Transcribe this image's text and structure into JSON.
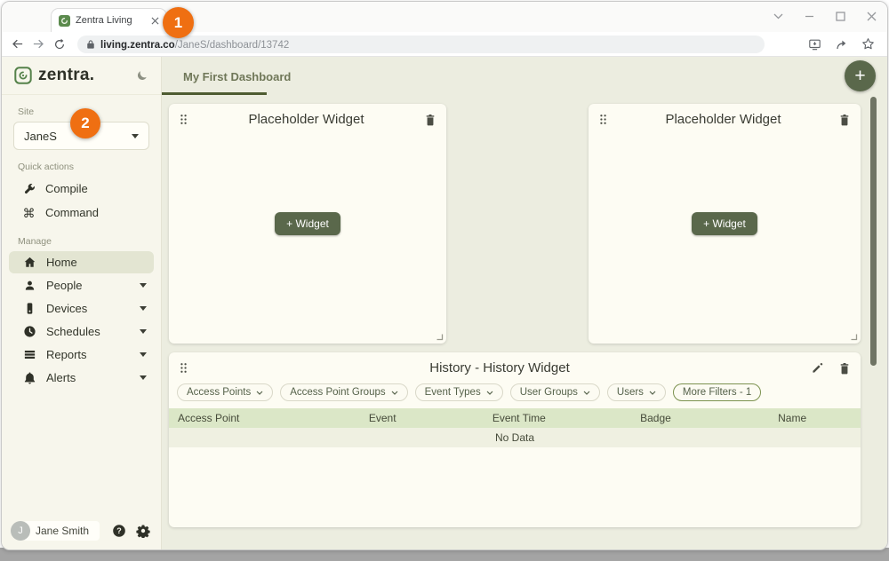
{
  "colors": {
    "accent_olive": "#5a684b",
    "tab_underline": "#4e5c31",
    "brand_green": "#55824a",
    "annotation_orange": "#ef6f12",
    "table_header_green": "#dbe7c7",
    "sidebar_bg": "#f7f6ec",
    "main_bg": "#ecede0",
    "card_bg": "#fdfcf3",
    "active_item_bg": "#e3e5d2"
  },
  "annotations": {
    "steps": [
      "1",
      "2"
    ]
  },
  "browser": {
    "tab_title": "Zentra Living",
    "url_domain": "living.zentra.co",
    "url_path": "/JaneS/dashboard/13742"
  },
  "icons": {
    "command_glyph": "⌘"
  },
  "sidebar": {
    "brand": "zentra.",
    "site_label": "Site",
    "site_value": "JaneS",
    "quick_actions_label": "Quick actions",
    "quick_actions": [
      {
        "label": "Compile"
      },
      {
        "label": "Command"
      }
    ],
    "manage_label": "Manage",
    "items": [
      {
        "label": "Home"
      },
      {
        "label": "People"
      },
      {
        "label": "Devices"
      },
      {
        "label": "Schedules"
      },
      {
        "label": "Reports"
      },
      {
        "label": "Alerts"
      }
    ],
    "user_initial": "J",
    "user_name": "Jane Smith"
  },
  "main": {
    "dashboard_tab": "My First Dashboard",
    "fab_label": "+",
    "widgets": [
      {
        "title": "Placeholder Widget",
        "add_button": "+ Widget"
      },
      {
        "title": "Placeholder Widget",
        "add_button": "+ Widget"
      }
    ],
    "history": {
      "title": "History - History Widget",
      "filters": [
        {
          "label": "Access Points"
        },
        {
          "label": "Access Point Groups"
        },
        {
          "label": "Event Types"
        },
        {
          "label": "User Groups"
        },
        {
          "label": "Users"
        }
      ],
      "more_filters": "More Filters - 1",
      "columns": [
        "Access Point",
        "Event",
        "Event Time",
        "Badge",
        "Name"
      ],
      "empty_text": "No Data"
    }
  }
}
